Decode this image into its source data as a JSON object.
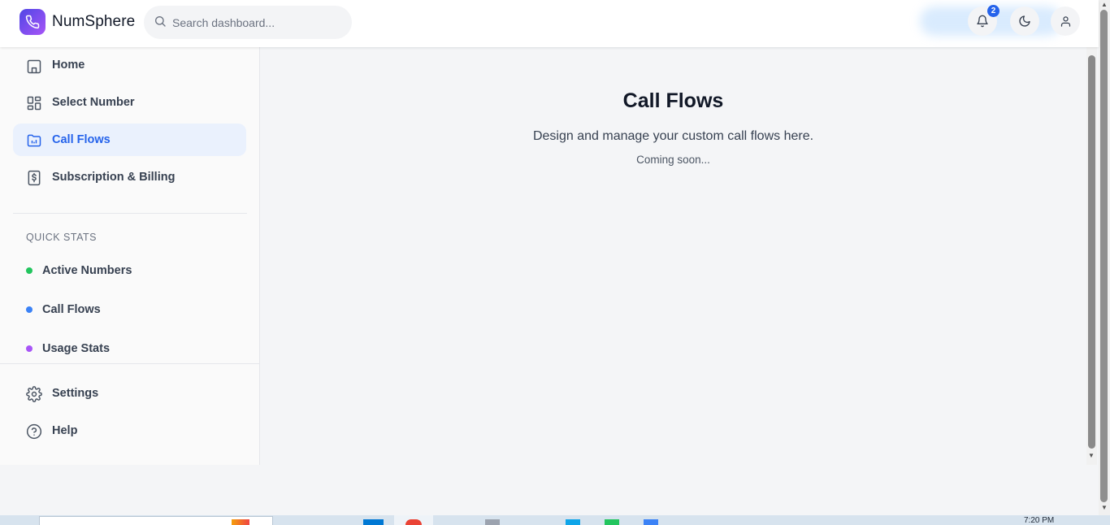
{
  "app": {
    "name": "NumSphere"
  },
  "header": {
    "search_placeholder": "Search dashboard...",
    "notification_count": "2"
  },
  "sidebar": {
    "nav_items": [
      {
        "label": "Home",
        "icon": "home-icon",
        "active": false
      },
      {
        "label": "Select Number",
        "icon": "grid-icon",
        "active": false
      },
      {
        "label": "Call Flows",
        "icon": "folder-chart-icon",
        "active": true
      },
      {
        "label": "Subscription & Billing",
        "icon": "dollar-receipt-icon",
        "active": false
      }
    ],
    "quick_stats_title": "QUICK STATS",
    "quick_stats": [
      {
        "label": "Active Numbers",
        "color": "#22c55e"
      },
      {
        "label": "Call Flows",
        "color": "#3b82f6"
      },
      {
        "label": "Usage Stats",
        "color": "#a855f7"
      }
    ],
    "bottom_items": [
      {
        "label": "Settings",
        "icon": "gear-icon"
      },
      {
        "label": "Help",
        "icon": "help-circle-icon"
      }
    ]
  },
  "main": {
    "title": "Call Flows",
    "description": "Design and manage your custom call flows here.",
    "note": "Coming soon..."
  },
  "taskbar": {
    "clock": "7:20 PM"
  },
  "colors": {
    "accent": "#2563eb",
    "active_nav_bg": "#eaf1fd",
    "logo_gradient_start": "#4f46e5",
    "logo_gradient_end": "#a855f7"
  }
}
